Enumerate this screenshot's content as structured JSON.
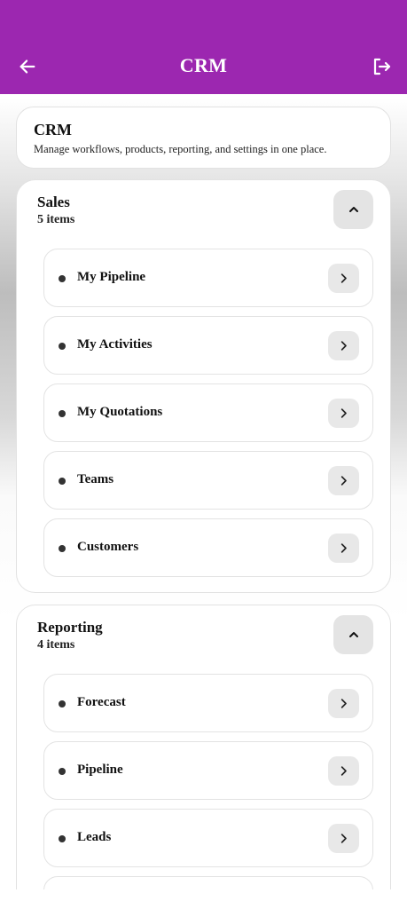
{
  "header": {
    "title": "CRM",
    "back_icon": "arrow-left-icon",
    "logout_icon": "logout-icon",
    "color": "#9c27b0"
  },
  "intro": {
    "title": "CRM",
    "description": "Manage workflows, products, reporting, and settings in one place."
  },
  "sections": [
    {
      "title": "Sales",
      "count": "5 items",
      "expanded": true,
      "items": [
        {
          "label": "My Pipeline"
        },
        {
          "label": "My Activities"
        },
        {
          "label": "My Quotations"
        },
        {
          "label": "Teams"
        },
        {
          "label": "Customers"
        }
      ]
    },
    {
      "title": "Reporting",
      "count": "4 items",
      "expanded": true,
      "items": [
        {
          "label": "Forecast"
        },
        {
          "label": "Pipeline"
        },
        {
          "label": "Leads"
        },
        {
          "label": ""
        }
      ]
    }
  ]
}
